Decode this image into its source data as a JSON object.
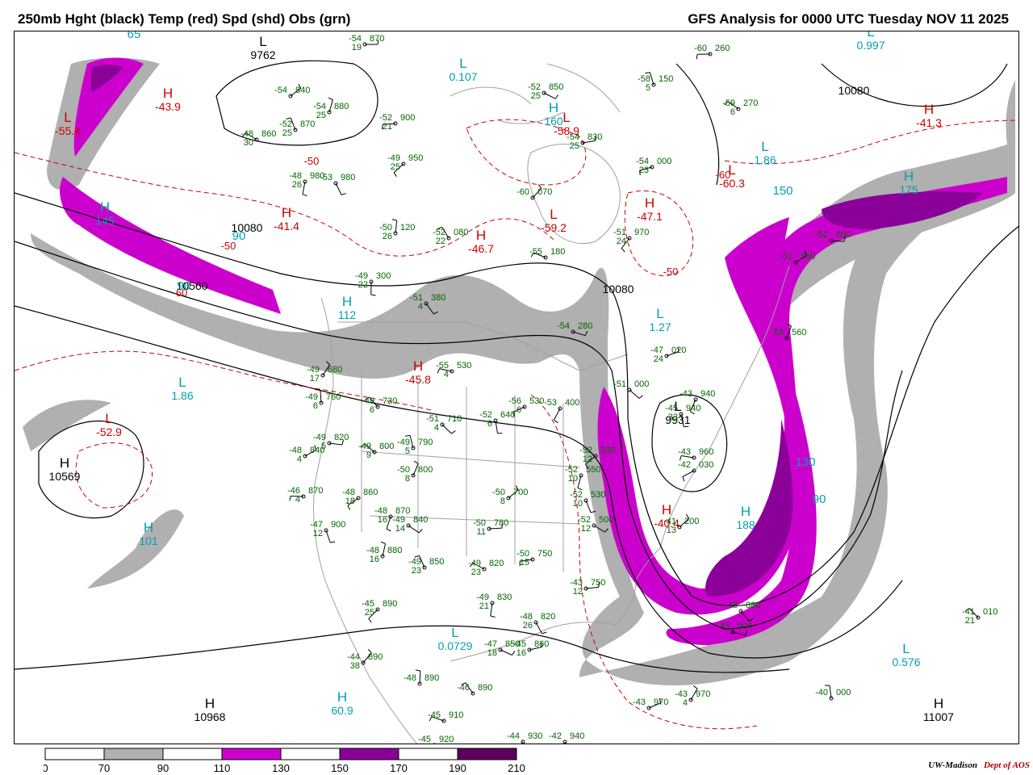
{
  "header": {
    "title_left": "250mb Hght (black) Temp (red) Spd (shd) Obs (grn)",
    "title_right": "GFS Analysis for 0000 UTC Tuesday  NOV 11 2025"
  },
  "legend": {
    "ticks": [
      "0",
      "70",
      "90",
      "110",
      "130",
      "150",
      "170",
      "190",
      "210"
    ],
    "bins": [
      {
        "from": 0,
        "to": 70,
        "color": "#ffffff"
      },
      {
        "from": 70,
        "to": 90,
        "color": "#b0b0b0"
      },
      {
        "from": 90,
        "to": 110,
        "color": "#ffffff"
      },
      {
        "from": 110,
        "to": 130,
        "color": "#cc00cc"
      },
      {
        "from": 130,
        "to": 150,
        "color": "#ffffff"
      },
      {
        "from": 150,
        "to": 170,
        "color": "#8a0099"
      },
      {
        "from": 170,
        "to": 190,
        "color": "#ffffff"
      },
      {
        "from": 190,
        "to": 210,
        "color": "#5c0060"
      }
    ]
  },
  "credit": {
    "org": "UW-Madison",
    "dept": "Dept of AOS"
  },
  "colors": {
    "height_contour": "#000000",
    "temp_contour": "#cc0000",
    "obs": "#006600",
    "jet_label": "#00a0b0",
    "geography": "#a0a0a0"
  },
  "map_labels": {
    "height_centers": [
      {
        "type": "H",
        "value": "10968"
      },
      {
        "type": "H",
        "value": "11007"
      },
      {
        "type": "L",
        "value": "9762"
      },
      {
        "type": "L",
        "value": "9931"
      },
      {
        "type": "H",
        "value": "10569"
      }
    ],
    "height_values": [
      "10080",
      "10560",
      "10080",
      "10080"
    ],
    "temp_centers": [
      {
        "type": "H",
        "value": "-43.9"
      },
      {
        "type": "H",
        "value": "-41.4"
      },
      {
        "type": "H",
        "value": "-46.7"
      },
      {
        "type": "H",
        "value": "-47.1"
      },
      {
        "type": "H",
        "value": "-45.8"
      },
      {
        "type": "L",
        "value": "-59.2"
      },
      {
        "type": "L",
        "value": "-52.9"
      },
      {
        "type": "H",
        "value": "-40.4"
      },
      {
        "type": "H",
        "value": "-41.3"
      },
      {
        "type": "L",
        "value": "-60.3"
      },
      {
        "type": "L",
        "value": "-58.9"
      },
      {
        "type": "L",
        "value": "-55.4"
      }
    ],
    "temp_values": [
      "-50",
      "-50",
      "-60",
      "-60",
      "-50"
    ],
    "speed_centers": [
      {
        "type": "H",
        "value": "145"
      },
      {
        "type": "H",
        "value": "112"
      },
      {
        "type": "H",
        "value": "101"
      },
      {
        "type": "H",
        "value": "60.9"
      },
      {
        "type": "H",
        "value": "188"
      },
      {
        "type": "H",
        "value": "175"
      },
      {
        "type": "H",
        "value": "160"
      },
      {
        "type": "L",
        "value": "1.86"
      },
      {
        "type": "L",
        "value": "0.0729"
      },
      {
        "type": "L",
        "value": "1.27"
      },
      {
        "type": "L",
        "value": "0.107"
      },
      {
        "type": "L",
        "value": "0.997"
      },
      {
        "type": "L",
        "value": "0.576"
      },
      {
        "type": "L",
        "value": "1.86"
      }
    ],
    "speed_values": [
      "90",
      "90",
      "150",
      "130",
      "90",
      "65"
    ],
    "stations": [
      {
        "t": "-54",
        "h": "870",
        "d": "19"
      },
      {
        "t": "-54",
        "h": "840",
        "d": ""
      },
      {
        "t": "-54",
        "h": "880",
        "d": "25"
      },
      {
        "t": "-52",
        "h": "870",
        "d": "25"
      },
      {
        "t": "-48",
        "h": "860",
        "d": "30"
      },
      {
        "t": "-52",
        "h": "900",
        "d": "21"
      },
      {
        "t": "-49",
        "h": "950",
        "d": "25"
      },
      {
        "t": "-48",
        "h": "980",
        "d": "26"
      },
      {
        "t": "-53",
        "h": "980",
        "d": ""
      },
      {
        "t": "-52",
        "h": "850",
        "d": "25"
      },
      {
        "t": "-54",
        "h": "830",
        "d": "25"
      },
      {
        "t": "-60",
        "h": "070",
        "d": ""
      },
      {
        "t": "-50",
        "h": "120",
        "d": "26"
      },
      {
        "t": "-52",
        "h": "080",
        "d": "22"
      },
      {
        "t": "-55",
        "h": "180",
        "d": ""
      },
      {
        "t": "-54",
        "h": "000",
        "d": "23"
      },
      {
        "t": "-51",
        "h": "970",
        "d": "24"
      },
      {
        "t": "-49",
        "h": "300",
        "d": "22"
      },
      {
        "t": "-51",
        "h": "380",
        "d": "4"
      },
      {
        "t": "-54",
        "h": "280",
        "d": ""
      },
      {
        "t": "-47",
        "h": "020",
        "d": "24"
      },
      {
        "t": "-49",
        "h": "680",
        "d": "17"
      },
      {
        "t": "-49",
        "h": "760",
        "d": "6"
      },
      {
        "t": "-49",
        "h": "730",
        "d": "6"
      },
      {
        "t": "-55",
        "h": "530",
        "d": "4"
      },
      {
        "t": "-56",
        "h": "530",
        "d": "6"
      },
      {
        "t": "-53",
        "h": "400",
        "d": ""
      },
      {
        "t": "-52",
        "h": "640",
        "d": "6"
      },
      {
        "t": "-51",
        "h": "710",
        "d": "4"
      },
      {
        "t": "-49",
        "h": "820",
        "d": "5"
      },
      {
        "t": "-48",
        "h": "840",
        "d": "4"
      },
      {
        "t": "-50",
        "h": "800",
        "d": "8"
      },
      {
        "t": "-49",
        "h": "790",
        "d": "5"
      },
      {
        "t": "-49",
        "h": "800",
        "d": "9"
      },
      {
        "t": "-46",
        "h": "870",
        "d": "4"
      },
      {
        "t": "-48",
        "h": "860",
        "d": "18"
      },
      {
        "t": "-48",
        "h": "870",
        "d": "16"
      },
      {
        "t": "-47",
        "h": "900",
        "d": "12"
      },
      {
        "t": "-49",
        "h": "840",
        "d": "14"
      },
      {
        "t": "-50",
        "h": "780",
        "d": "11"
      },
      {
        "t": "-50",
        "h": "700",
        "d": "8"
      },
      {
        "t": "-48",
        "h": "880",
        "d": "16"
      },
      {
        "t": "-49",
        "h": "850",
        "d": "23"
      },
      {
        "t": "-49",
        "h": "820",
        "d": "23"
      },
      {
        "t": "-50",
        "h": "750",
        "d": "15"
      },
      {
        "t": "-45",
        "h": "890",
        "d": "25"
      },
      {
        "t": "-49",
        "h": "830",
        "d": "21"
      },
      {
        "t": "-48",
        "h": "820",
        "d": "26"
      },
      {
        "t": "-47",
        "h": "850",
        "d": "18"
      },
      {
        "t": "-45",
        "h": "860",
        "d": "16"
      },
      {
        "t": "-44",
        "h": "890",
        "d": "38"
      },
      {
        "t": "-48",
        "h": "890",
        "d": ""
      },
      {
        "t": "-46",
        "h": "890",
        "d": ""
      },
      {
        "t": "-45",
        "h": "910",
        "d": ""
      },
      {
        "t": "-45",
        "h": "920",
        "d": ""
      },
      {
        "t": "-44",
        "h": "930",
        "d": ""
      },
      {
        "t": "-42",
        "h": "940",
        "d": ""
      },
      {
        "t": "-43",
        "h": "880",
        "d": ""
      },
      {
        "t": "-43",
        "h": "900",
        "d": ""
      },
      {
        "t": "-43",
        "h": "970",
        "d": ""
      },
      {
        "t": "-43",
        "h": "970",
        "d": "4"
      },
      {
        "t": "-40",
        "h": "000",
        "d": ""
      },
      {
        "t": "-41",
        "h": "010",
        "d": "21"
      },
      {
        "t": "-43",
        "h": "960",
        "d": ""
      },
      {
        "t": "-42",
        "h": "030",
        "d": ""
      },
      {
        "t": "-43",
        "h": "940",
        "d": ""
      },
      {
        "t": "-45",
        "h": "940",
        "d": "33"
      },
      {
        "t": "-51",
        "h": "000",
        "d": ""
      },
      {
        "t": "-52",
        "h": "600",
        "d": ""
      },
      {
        "t": "-51",
        "h": "560",
        "d": ""
      },
      {
        "t": "-53",
        "h": "560",
        "d": ""
      },
      {
        "t": "-58",
        "h": "150",
        "d": "5"
      },
      {
        "t": "-59",
        "h": "270",
        "d": "6"
      },
      {
        "t": "-60",
        "h": "260",
        "d": ""
      },
      {
        "t": "-52",
        "h": "530",
        "d": "12"
      },
      {
        "t": "-52",
        "h": "550",
        "d": "10"
      },
      {
        "t": "-52",
        "h": "530",
        "d": "10"
      },
      {
        "t": "-52",
        "h": "500",
        "d": "12"
      },
      {
        "t": "-43",
        "h": "750",
        "d": "12"
      },
      {
        "t": "-41",
        "h": "200",
        "d": "13"
      }
    ]
  }
}
